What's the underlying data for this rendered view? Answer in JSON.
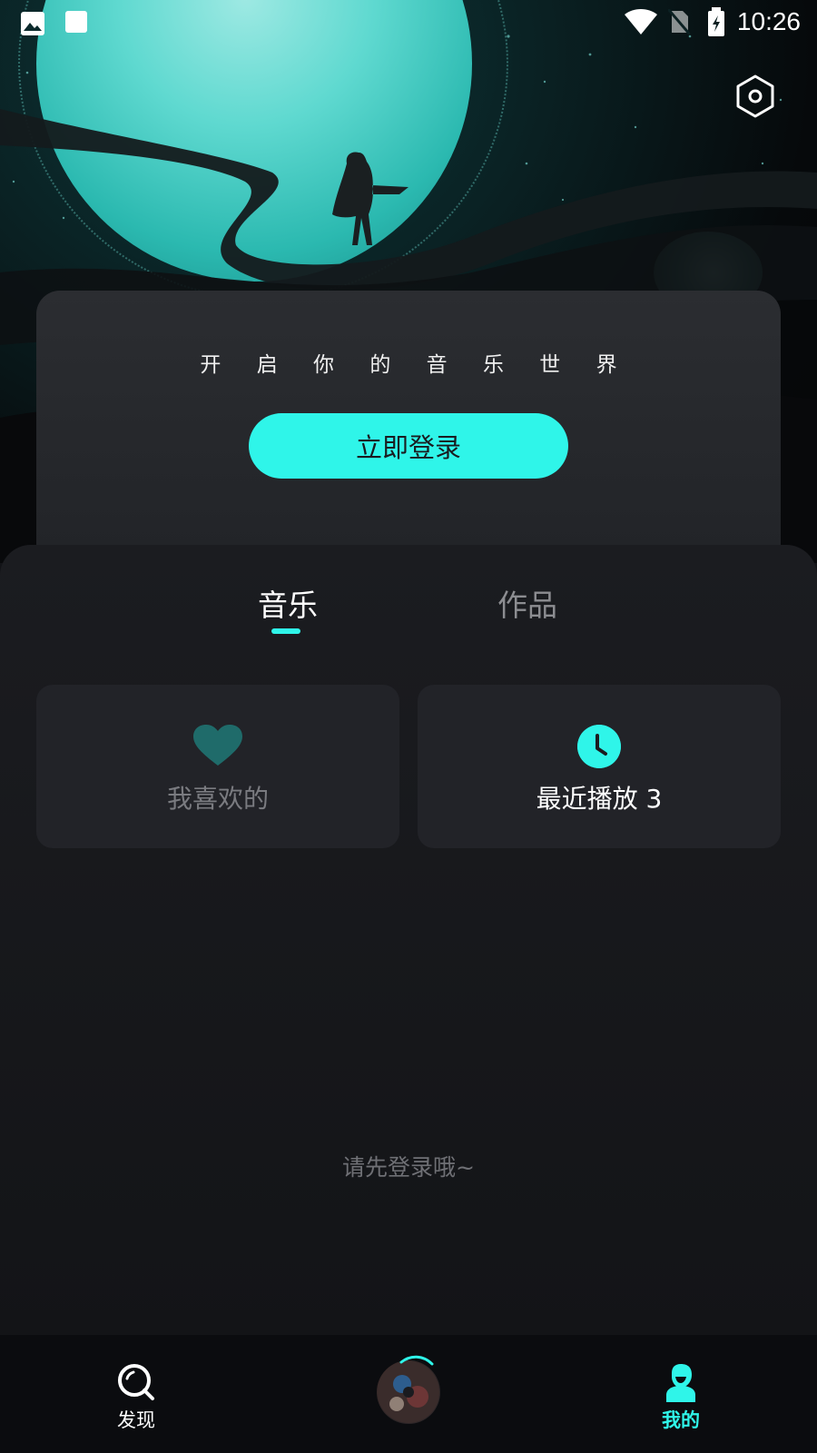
{
  "status_bar": {
    "time": "10:26"
  },
  "login_card": {
    "tagline": "开 启 你 的 音 乐 世 界",
    "login_button": "立即登录"
  },
  "tabs": [
    {
      "label": "音乐",
      "active": true
    },
    {
      "label": "作品",
      "active": false
    }
  ],
  "cards": {
    "favorites": {
      "label": "我喜欢的",
      "icon": "heart-icon"
    },
    "recent": {
      "label": "最近播放 3",
      "icon": "clock-icon"
    }
  },
  "empty_hint": "请先登录哦~",
  "bottom_nav": {
    "discover": {
      "label": "发现",
      "icon": "search-icon"
    },
    "now_playing": {
      "icon": "album-disc-icon"
    },
    "mine": {
      "label": "我的",
      "icon": "user-icon",
      "active": true
    }
  },
  "colors": {
    "accent": "#2ff5e9",
    "background": "#121317",
    "card": "#222328"
  }
}
